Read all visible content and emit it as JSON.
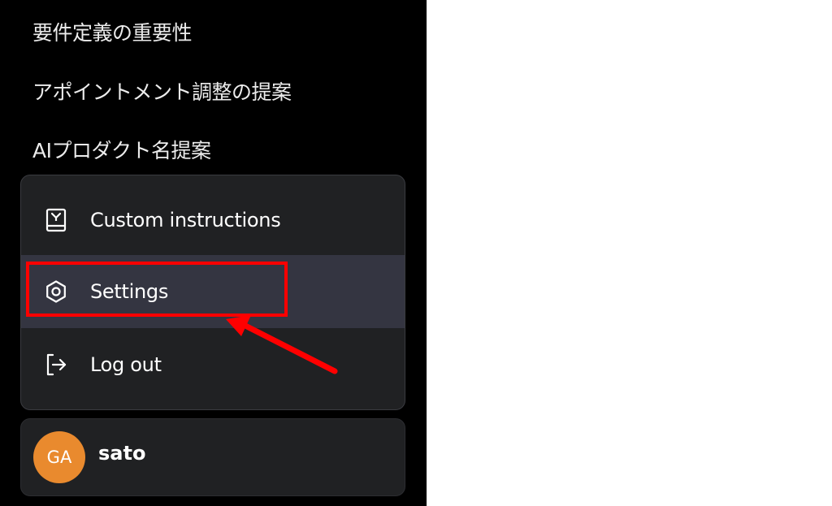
{
  "history": [
    {
      "label": "要件定義の重要性"
    },
    {
      "label": "アポイントメント調整の提案"
    },
    {
      "label": "AIプロダクト名提案"
    }
  ],
  "menu": {
    "items": [
      {
        "label": "Custom instructions",
        "icon": "instructions-icon"
      },
      {
        "label": "Settings",
        "icon": "gear-icon"
      },
      {
        "label": "Log out",
        "icon": "logout-icon"
      }
    ]
  },
  "user": {
    "initials": "GA",
    "name": "sato",
    "avatar_color": "#e98a2e"
  },
  "annotation": {
    "color": "#ff0000"
  }
}
